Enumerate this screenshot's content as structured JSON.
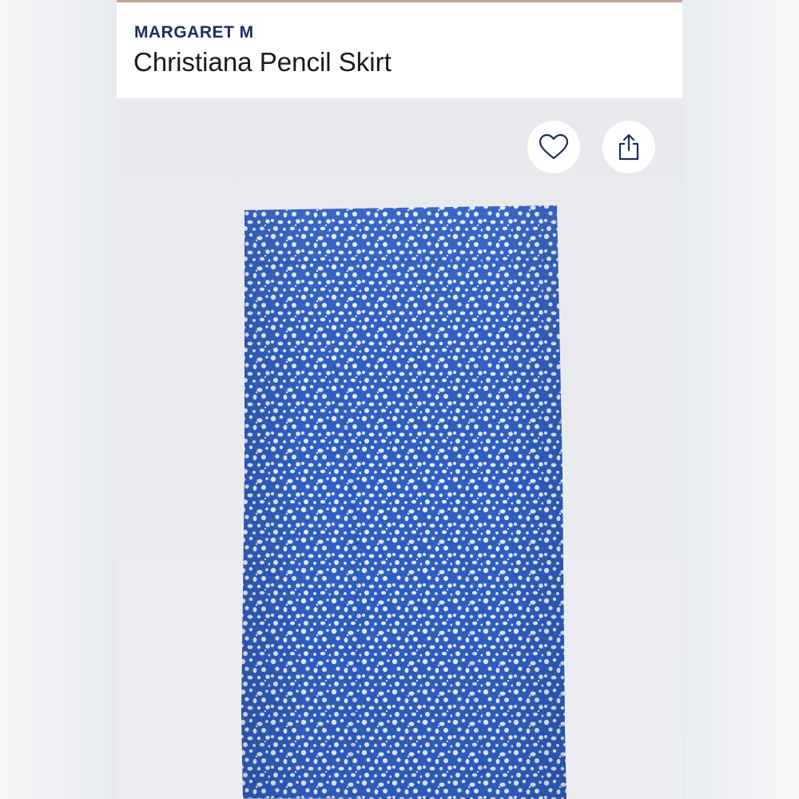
{
  "product": {
    "brand": "MARGARET M",
    "name": "Christiana Pencil Skirt"
  },
  "actions": {
    "favorite_icon": "heart-outline-icon",
    "share_icon": "share-upload-icon"
  },
  "image": {
    "subject": "blue and white speckled print pencil skirt",
    "colors": {
      "fabric_blue": "#2f5fc4",
      "fabric_white": "#e8eefa",
      "brand_navy": "#1d2c5c"
    }
  }
}
